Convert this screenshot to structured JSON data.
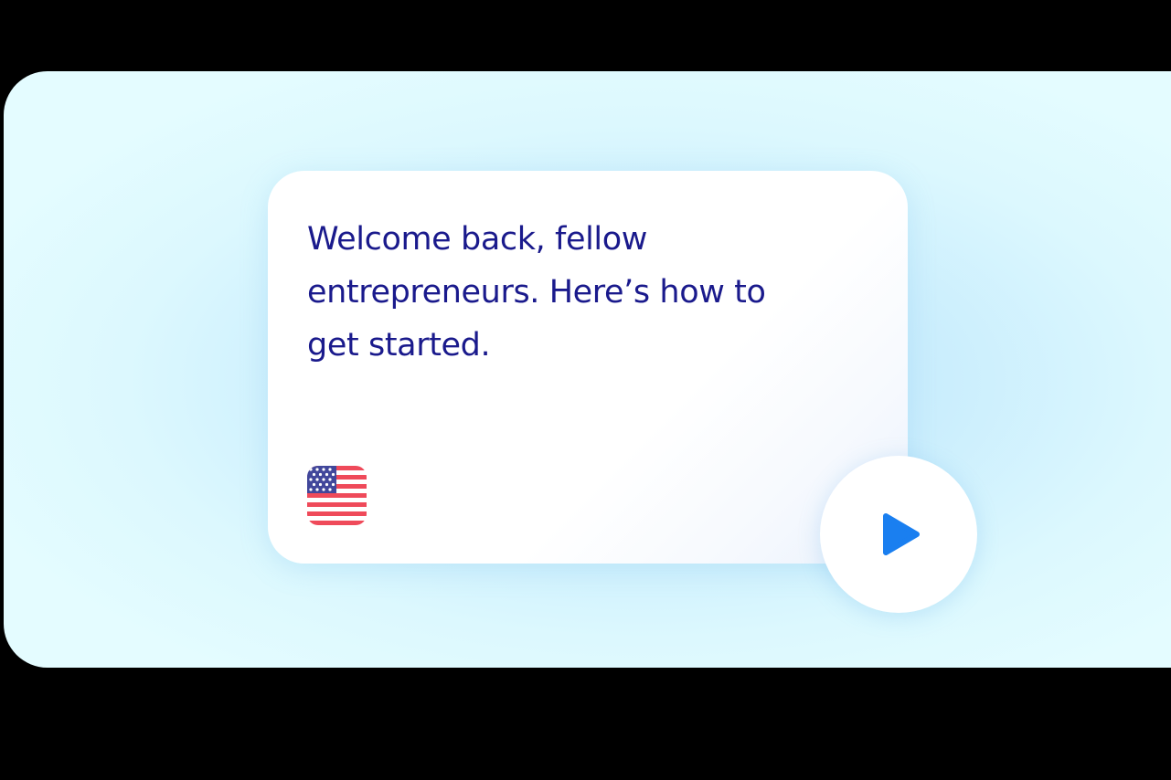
{
  "card": {
    "message": "Welcome back, fellow entrepreneurs. Here’s how to get started."
  },
  "language": {
    "flag_icon": "us-flag-icon"
  },
  "player": {
    "play_icon": "play-icon",
    "accent_color": "#1a7ff0"
  },
  "colors": {
    "text": "#1a1a8c",
    "card_background": "#ffffff",
    "stage_background": "#dcf8fe"
  }
}
